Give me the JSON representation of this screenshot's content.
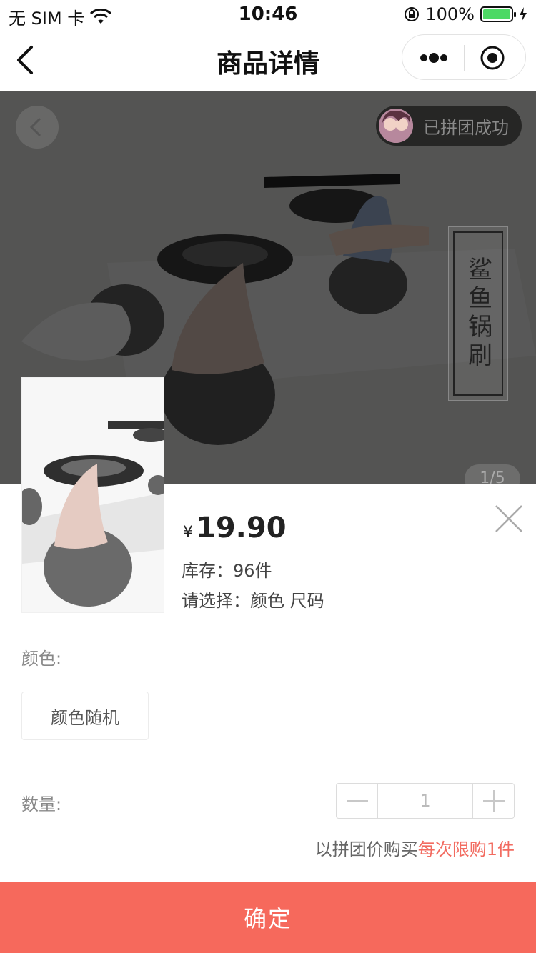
{
  "status_bar": {
    "carrier": "无 SIM 卡",
    "time": "10:46",
    "battery": "100%",
    "battery_level_fraction": 1.0
  },
  "nav": {
    "title": "商品详情"
  },
  "hero": {
    "group_badge": "已拼团成功",
    "vertical_label": "鲨鱼锅刷",
    "page_indicator": "1/5"
  },
  "sheet": {
    "price_symbol": "¥",
    "price": "19.90",
    "stock": "库存：96件",
    "choose": "请选择：颜色 尺码",
    "color_label": "颜色:",
    "color_options": [
      "颜色随机"
    ],
    "quantity_label": "数量:",
    "quantity_value": "1",
    "limit_prefix": "以拼团价购买",
    "limit_highlight": "每次限购1件",
    "confirm_label": "确定"
  },
  "colors": {
    "accent": "#f6695c",
    "highlight_text": "#f26b60",
    "battery": "#4cd964"
  }
}
